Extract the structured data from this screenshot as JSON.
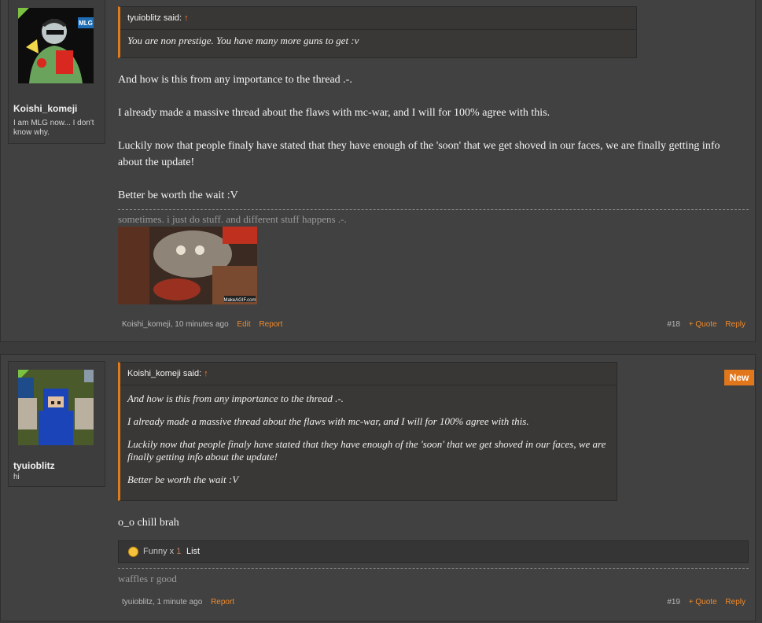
{
  "posts": [
    {
      "author": "Koishi_komeji",
      "user_title": "I am MLG now... I don't know why.",
      "quote": {
        "author": "tyuioblitz said:",
        "arrow": "↑",
        "paragraphs": [
          "You are non prestige. You have many more guns to get :v"
        ]
      },
      "message": [
        "And how is this from any importance to the thread .-.",
        "I already made a massive thread about the flaws with mc-war, and I will for 100% agree with this.",
        "Luckily now that people finaly have stated that they have enough of the 'soon' that we get shoved in our faces, we are finally getting info about the update!",
        "Better be worth the wait :V"
      ],
      "signature": "sometimes. i just do stuff. and different stuff happens .-.",
      "signature_image_caption": "MakeAGIF.com",
      "avatar_badge": "MLG",
      "footer": {
        "meta": "Koishi_komeji, 10 minutes ago",
        "links": [
          "Edit",
          "Report"
        ]
      },
      "post_number": "#18",
      "quote_link": "+ Quote",
      "reply_link": "Reply"
    },
    {
      "author": "tyuioblitz",
      "user_title": "hi",
      "new_badge": "New",
      "quote": {
        "author": "Koishi_komeji said:",
        "arrow": "↑",
        "paragraphs": [
          "And how is this from any importance to the thread .-.",
          "I already made a massive thread about the flaws with mc-war, and I will for 100% agree with this.",
          "Luckily now that people finaly have stated that they have enough of the 'soon' that we get shoved in our faces, we are finally getting info about the update!",
          "Better be worth the wait :V"
        ]
      },
      "message": [
        "o_o chill brah"
      ],
      "likes": {
        "icon": "smile-icon",
        "label": "Funny x",
        "count": "1",
        "list": "List"
      },
      "signature": "waffles r good",
      "footer": {
        "meta": "tyuioblitz, 1 minute ago",
        "links": [
          "Report"
        ]
      },
      "post_number": "#19",
      "quote_link": "+ Quote",
      "reply_link": "Reply"
    }
  ],
  "colors": {
    "accent": "#e07b1b",
    "link": "#f08a2c",
    "background": "#414141"
  }
}
